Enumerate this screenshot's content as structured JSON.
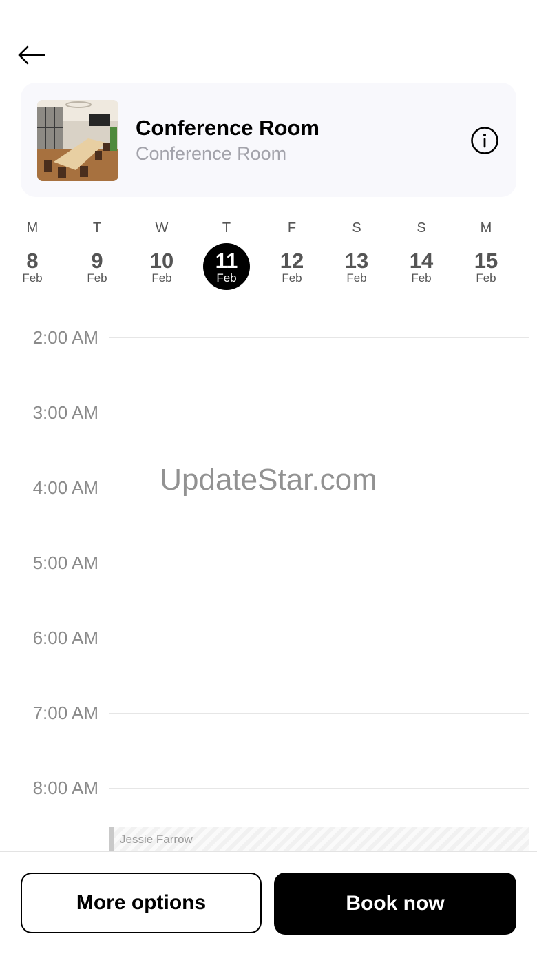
{
  "header": {
    "back_icon": "arrow-left-icon",
    "info_icon": "info-icon"
  },
  "room": {
    "title": "Conference Room",
    "subtitle": "Conference Room"
  },
  "week": [
    {
      "letter": "M",
      "day": "8",
      "month": "Feb",
      "selected": false
    },
    {
      "letter": "T",
      "day": "9",
      "month": "Feb",
      "selected": false
    },
    {
      "letter": "W",
      "day": "10",
      "month": "Feb",
      "selected": false
    },
    {
      "letter": "T",
      "day": "11",
      "month": "Feb",
      "selected": true
    },
    {
      "letter": "F",
      "day": "12",
      "month": "Feb",
      "selected": false
    },
    {
      "letter": "S",
      "day": "13",
      "month": "Feb",
      "selected": false
    },
    {
      "letter": "S",
      "day": "14",
      "month": "Feb",
      "selected": false
    },
    {
      "letter": "M",
      "day": "15",
      "month": "Feb",
      "selected": false
    }
  ],
  "timeline": {
    "hours": [
      "2:00 AM",
      "3:00 AM",
      "4:00 AM",
      "5:00 AM",
      "6:00 AM",
      "7:00 AM",
      "8:00 AM"
    ],
    "booking": {
      "name": "Jessie Farrow"
    }
  },
  "watermark": "UpdateStar.com",
  "footer": {
    "more_label": "More options",
    "book_label": "Book now"
  },
  "colors": {
    "primary": "#000000",
    "card_bg": "#f8f8fc",
    "muted_text": "#a3a3ab"
  }
}
